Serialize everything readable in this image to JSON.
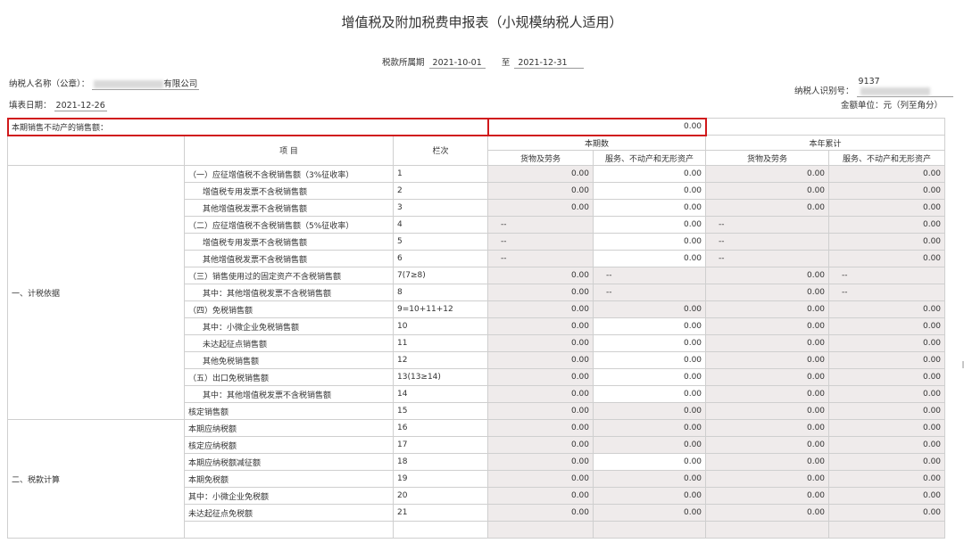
{
  "title": "增值税及附加税费申报表（小规模纳税人适用）",
  "period": {
    "label": "税款所属期",
    "from": "2021-10-01",
    "to_label": "至",
    "to": "2021-12-31"
  },
  "taxpayer": {
    "name_label": "纳税人名称（公章）：",
    "name_suffix": "有限公司",
    "id_label": "纳税人识别号：",
    "id_value": "9137"
  },
  "fill": {
    "date_label": "填表日期：",
    "date": "2021-12-26",
    "unit": "金额单位：元（列至角分）"
  },
  "realestate": {
    "label": "本期销售不动产的销售额：",
    "value": "0.00"
  },
  "header": {
    "item": "项 目",
    "col": "栏次",
    "current": "本期数",
    "ytd": "本年累计",
    "goods": "货物及劳务",
    "services": "服务、不动产和无形资产"
  },
  "sections": [
    "一、计税依据",
    "二、税款计算"
  ],
  "rows": [
    {
      "item": "（一）应征增值税不含税销售额（3%征收率）",
      "col": "1",
      "a": "0.00",
      "b": "0.00",
      "c": "0.00",
      "d": "0.00"
    },
    {
      "item": "增值税专用发票不含税销售额",
      "col": "2",
      "a": "0.00",
      "b": "0.00",
      "c": "0.00",
      "d": "0.00"
    },
    {
      "item": "其他增值税发票不含税销售额",
      "col": "3",
      "a": "0.00",
      "b": "0.00",
      "c": "0.00",
      "d": "0.00"
    },
    {
      "item": "（二）应征增值税不含税销售额（5%征收率）",
      "col": "4",
      "a": "--",
      "b": "0.00",
      "c": "--",
      "d": "0.00"
    },
    {
      "item": "增值税专用发票不含税销售额",
      "col": "5",
      "a": "--",
      "b": "0.00",
      "c": "--",
      "d": "0.00"
    },
    {
      "item": "其他增值税发票不含税销售额",
      "col": "6",
      "a": "--",
      "b": "0.00",
      "c": "--",
      "d": "0.00"
    },
    {
      "item": "（三）销售使用过的固定资产不含税销售额",
      "col": "7(7≥8)",
      "a": "0.00",
      "b": "--",
      "c": "0.00",
      "d": "--"
    },
    {
      "item": "其中：其他增值税发票不含税销售额",
      "col": "8",
      "a": "0.00",
      "b": "--",
      "c": "0.00",
      "d": "--"
    },
    {
      "item": "（四）免税销售额",
      "col": "9=10+11+12",
      "a": "0.00",
      "b": "0.00",
      "c": "0.00",
      "d": "0.00"
    },
    {
      "item": "其中：小微企业免税销售额",
      "col": "10",
      "a": "0.00",
      "b": "0.00",
      "c": "0.00",
      "d": "0.00"
    },
    {
      "item": "未达起征点销售额",
      "col": "11",
      "a": "0.00",
      "b": "0.00",
      "c": "0.00",
      "d": "0.00"
    },
    {
      "item": "其他免税销售额",
      "col": "12",
      "a": "0.00",
      "b": "0.00",
      "c": "0.00",
      "d": "0.00"
    },
    {
      "item": "（五）出口免税销售额",
      "col": "13(13≥14)",
      "a": "0.00",
      "b": "0.00",
      "c": "0.00",
      "d": "0.00"
    },
    {
      "item": "其中：其他增值税发票不含税销售额",
      "col": "14",
      "a": "0.00",
      "b": "0.00",
      "c": "0.00",
      "d": "0.00"
    },
    {
      "item": "核定销售额",
      "col": "15",
      "a": "0.00",
      "b": "0.00",
      "c": "0.00",
      "d": "0.00"
    },
    {
      "item": "本期应纳税额",
      "col": "16",
      "a": "0.00",
      "b": "0.00",
      "c": "0.00",
      "d": "0.00"
    },
    {
      "item": "核定应纳税额",
      "col": "17",
      "a": "0.00",
      "b": "0.00",
      "c": "0.00",
      "d": "0.00"
    },
    {
      "item": "本期应纳税额减征额",
      "col": "18",
      "a": "0.00",
      "b": "0.00",
      "c": "0.00",
      "d": "0.00"
    },
    {
      "item": "本期免税额",
      "col": "19",
      "a": "0.00",
      "b": "0.00",
      "c": "0.00",
      "d": "0.00"
    },
    {
      "item": "其中：小微企业免税额",
      "col": "20",
      "a": "0.00",
      "b": "0.00",
      "c": "0.00",
      "d": "0.00"
    },
    {
      "item": "未达起征点免税额",
      "col": "21",
      "a": "0.00",
      "b": "0.00",
      "c": "0.00",
      "d": "0.00"
    }
  ]
}
